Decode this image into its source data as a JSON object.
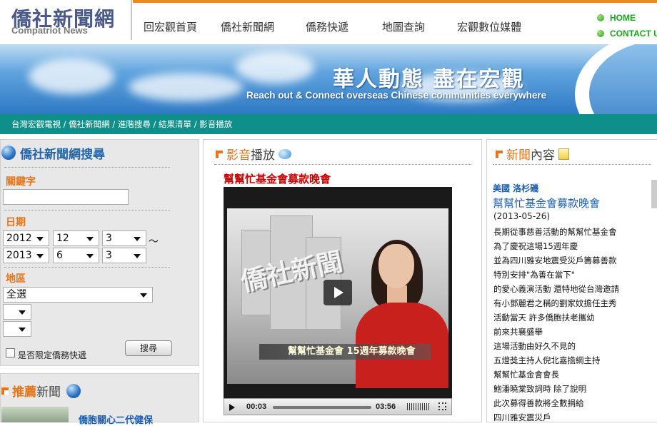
{
  "logo": {
    "zh": "僑社新聞網",
    "en": "Compatriot News"
  },
  "nav": [
    "回宏觀首頁",
    "僑社新聞網",
    "僑務快遞",
    "地圖查詢",
    "宏觀數位媒體"
  ],
  "side_links": [
    "HOME",
    "CONTACT US"
  ],
  "banner": {
    "title": "華人動態  盡在宏觀",
    "subtitle": "Reach out & Connect  overseas Chinese communities everywhere"
  },
  "breadcrumb": "台灣宏觀電視 / 僑社新聞網 / 進階搜尋 / 結果清單 / 影音播放",
  "search": {
    "title": "僑社新聞網搜尋",
    "keyword_label": "關鍵字",
    "keyword_value": "",
    "date_label": "日期",
    "date_from": {
      "year": "2012",
      "month": "12",
      "day": "3"
    },
    "date_sep": "～",
    "date_to": {
      "year": "2013",
      "month": "6",
      "day": "3"
    },
    "region_label": "地區",
    "region_value": "全選",
    "region_sub1": "",
    "region_sub2": "",
    "checkbox_label": "是否限定僑務快遞",
    "search_button": "搜尋"
  },
  "recommended": {
    "title_a": "推薦",
    "title_b": "新聞",
    "first_item": "僑胞關心二代健保"
  },
  "video": {
    "section_a": "影音",
    "section_b": "播放",
    "title": "幫幫忙基金會募款晚會",
    "logo_text": "僑社新聞",
    "caption": "幫幫忙基金會 15週年募款晚會",
    "time_current": "00:03",
    "time_total": "03:56"
  },
  "news": {
    "section_a": "新聞",
    "section_b": "內容",
    "location": "美國 洛杉磯",
    "title": "幫幫忙基金會募款晚會",
    "date": "(2013-05-26)",
    "lines": [
      "長期從事慈善活動的幫幫忙基金會",
      "為了慶祝這場15週年慶",
      "並為四川雅安地震受災戶籌募善款",
      "特別安排\"為善在當下\"",
      "的愛心義演活動 還特地從台灣邀請",
      "有小鄧麗君之稱的劉家妏擔任主秀",
      "活動當天 許多僑胞扶老攜幼",
      "前來共襄盛舉",
      "這場活動由好久不見的",
      "五燈獎主持人倪北嘉擔綱主持",
      "幫幫忙基金會會長",
      "鮑潘曉棠致詞時 除了說明",
      "此次募得善款將全數捐給",
      "四川雅安震災戶"
    ]
  }
}
